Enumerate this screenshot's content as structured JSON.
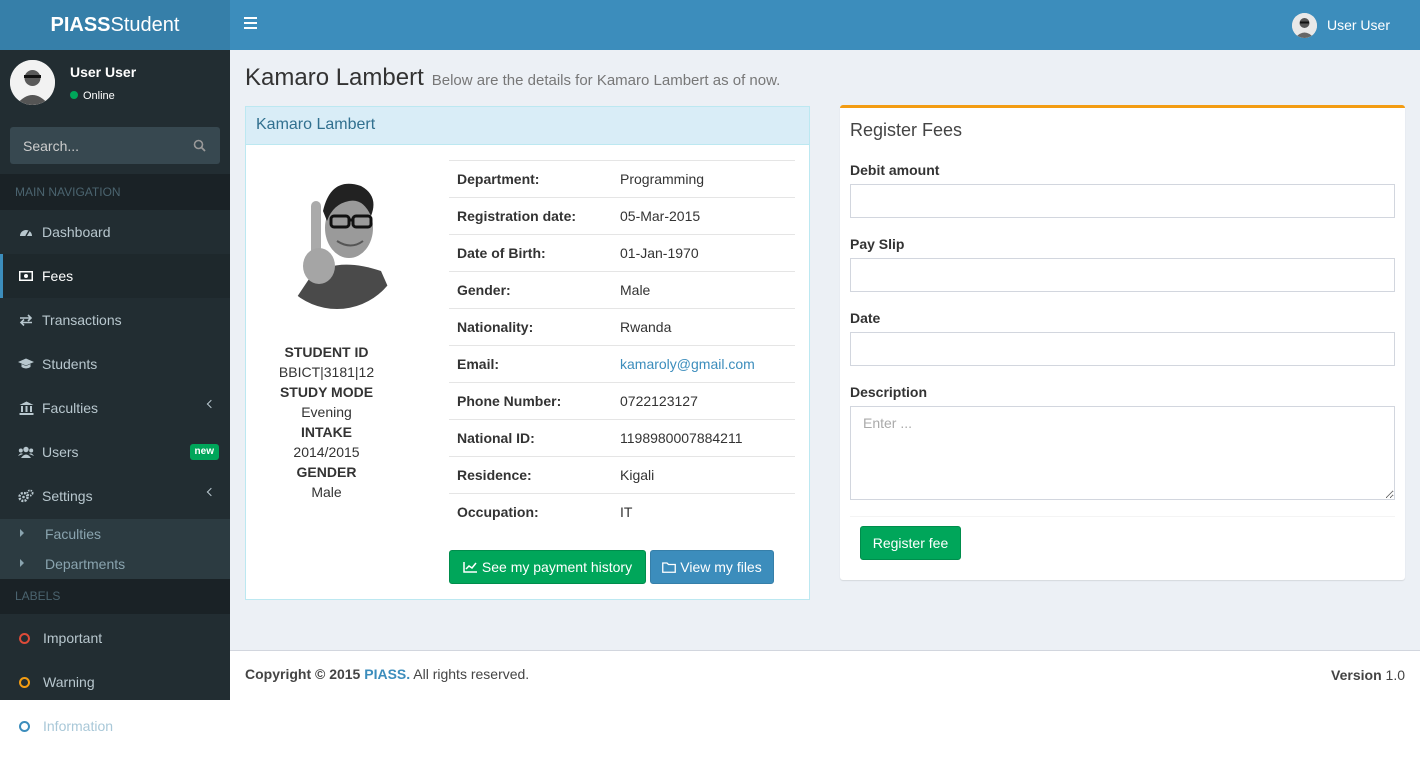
{
  "app": {
    "logo_bold": "PIASS",
    "logo_rest": "Student"
  },
  "header": {
    "user_name": "User User"
  },
  "sidebar": {
    "user_name": "User User",
    "status": "Online",
    "search_placeholder": "Search...",
    "main_nav_label": "MAIN NAVIGATION",
    "items": [
      {
        "label": "Dashboard",
        "icon": "dashboard-icon"
      },
      {
        "label": "Fees",
        "icon": "money-icon"
      },
      {
        "label": "Transactions",
        "icon": "exchange-icon"
      },
      {
        "label": "Students",
        "icon": "graduation-cap-icon"
      },
      {
        "label": "Faculties",
        "icon": "bank-icon"
      },
      {
        "label": "Users",
        "icon": "users-icon",
        "badge": "new"
      },
      {
        "label": "Settings",
        "icon": "gears-icon"
      }
    ],
    "settings_sub": [
      "Faculties",
      "Departments"
    ],
    "labels_header": "LABELS",
    "labels": [
      {
        "label": "Important",
        "color": "#dd4b39"
      },
      {
        "label": "Warning",
        "color": "#f39c12"
      },
      {
        "label": "Information",
        "color": "#00c0ef"
      }
    ]
  },
  "page": {
    "title": "Kamaro Lambert",
    "subtitle": "Below are the details for Kamaro Lambert as of now."
  },
  "profile": {
    "box_title": "Kamaro Lambert",
    "student_id_label": "STUDENT ID",
    "student_id": "BBICT|3181|12",
    "study_mode_label": "STUDY MODE",
    "study_mode": "Evening",
    "intake_label": "INTAKE",
    "intake": "2014/2015",
    "gender_label": "GENDER",
    "gender": "Male",
    "details": [
      {
        "key": "Department:",
        "value": "Programming"
      },
      {
        "key": "Registration date:",
        "value": "05-Mar-2015"
      },
      {
        "key": "Date of Birth:",
        "value": "01-Jan-1970"
      },
      {
        "key": "Gender:",
        "value": "Male"
      },
      {
        "key": "Nationality:",
        "value": "Rwanda"
      },
      {
        "key": "Email:",
        "value": "kamaroly@gmail.com"
      },
      {
        "key": "Phone Number:",
        "value": "0722123127"
      },
      {
        "key": "National ID:",
        "value": "1198980007884211"
      },
      {
        "key": "Residence:",
        "value": "Kigali"
      },
      {
        "key": "Occupation:",
        "value": "IT"
      }
    ],
    "payment_history_btn": "See my payment history",
    "files_btn": "View my files"
  },
  "fees_form": {
    "title": "Register Fees",
    "debit_label": "Debit amount",
    "payslip_label": "Pay Slip",
    "date_label": "Date",
    "description_label": "Description",
    "description_placeholder": "Enter ...",
    "submit_label": "Register fee"
  },
  "footer": {
    "copyright": "Copyright © 2015",
    "brand": "PIASS.",
    "rights": "All rights reserved.",
    "version_label": "Version",
    "version": "1.0"
  }
}
